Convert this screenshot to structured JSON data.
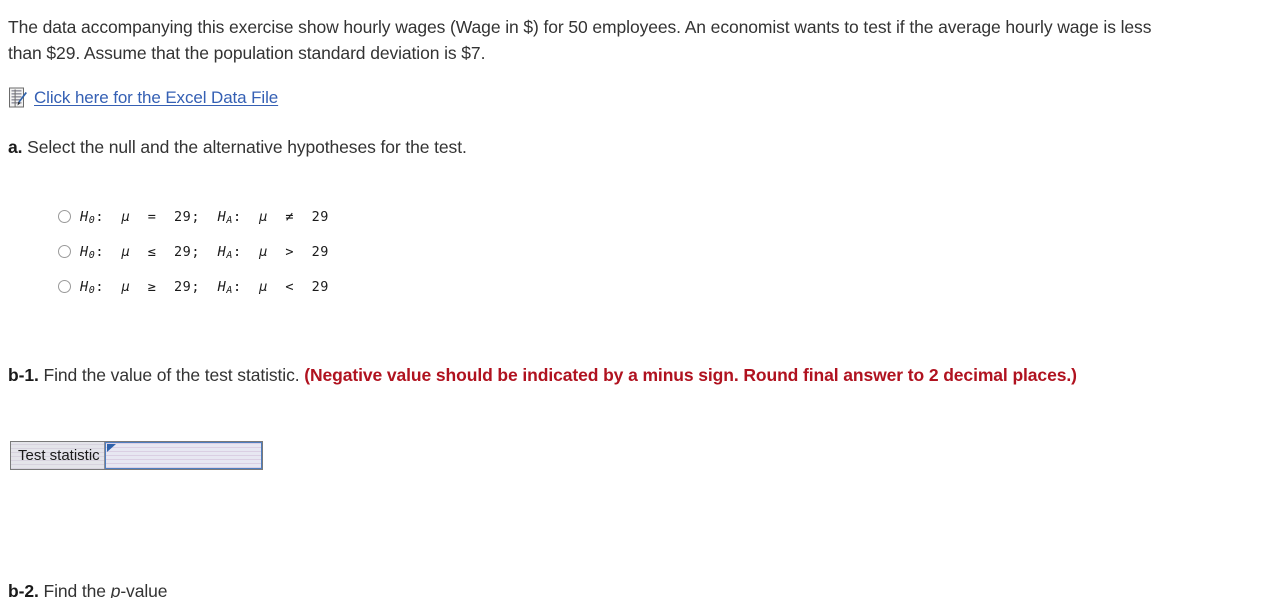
{
  "intro": {
    "text": "The data accompanying this exercise show hourly wages (Wage in $) for 50 employees. An economist wants to test if the average hourly wage is less than $29. Assume that the population standard deviation is $7."
  },
  "datafile": {
    "icon": "excel-document-icon",
    "link_label": "Click here for the Excel Data File",
    "link_color": "#3560b4"
  },
  "parts": {
    "a": {
      "label": "a.",
      "prompt": "Select the null and the alternative hypotheses for the test.",
      "options": [
        {
          "h0_symbol": "H",
          "h0_sub": "0",
          "h0_rel": "=",
          "value": "29",
          "ha_symbol": "H",
          "ha_sub": "A",
          "ha_rel": "≠",
          "text": "H0: μ = 29; HA: μ ≠ 29"
        },
        {
          "h0_symbol": "H",
          "h0_sub": "0",
          "h0_rel": "≤",
          "value": "29",
          "ha_symbol": "H",
          "ha_sub": "A",
          "ha_rel": ">",
          "text": "H0: μ ≤ 29; HA: μ > 29"
        },
        {
          "h0_symbol": "H",
          "h0_sub": "0",
          "h0_rel": "≥",
          "value": "29",
          "ha_symbol": "H",
          "ha_sub": "A",
          "ha_rel": "<",
          "text": "H0: μ ≥ 29; HA: μ < 29"
        }
      ],
      "mu": "μ",
      "colon": ":",
      "semicolon": ";"
    },
    "b1": {
      "label": "b-1.",
      "prompt": "Find the value of the test statistic.",
      "note": "(Negative value should be indicated by a minus sign. Round final answer to 2 decimal places.)",
      "note_color": "#b0121f",
      "answer_row_label": "Test statistic",
      "answer_value": "",
      "answer_placeholder": ""
    },
    "b2": {
      "label": "b-2.",
      "prompt_pre": "Find the ",
      "prompt_italic": "p",
      "prompt_post": "-value"
    }
  }
}
